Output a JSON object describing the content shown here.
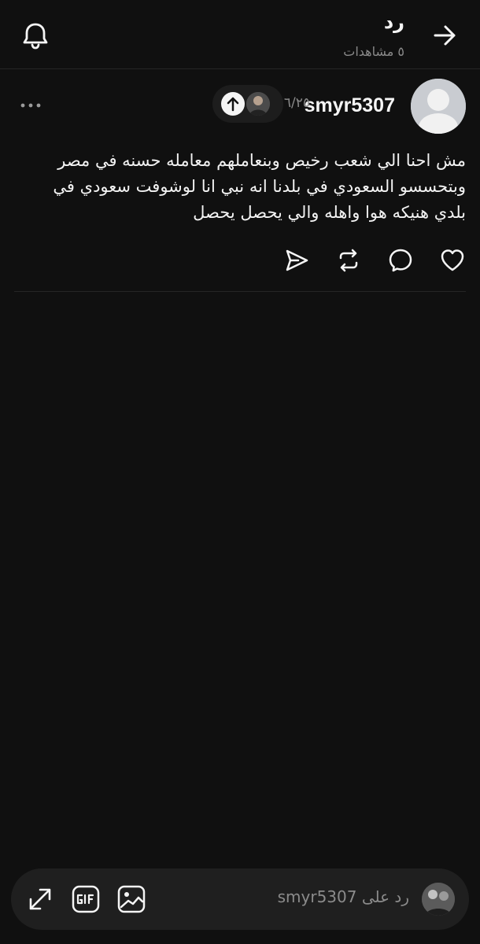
{
  "header": {
    "title": "رد",
    "views": "٥ مشاهدات",
    "back_icon": "arrow-right-icon",
    "notifications_icon": "bell-icon"
  },
  "post": {
    "username": "smyr5307",
    "thread_position": "٦/٢٥",
    "text": "مش احنا الي شعب رخيص وبنعاملهم معامله حسنه في مصر وبتحسسو السعودي في بلدنا انه نبي انا لوشوفت سعودي في بلدي هنيكه هوا واهله والي يحصل يحصل",
    "actions": [
      "like-icon",
      "comment-icon",
      "repost-icon",
      "share-icon"
    ]
  },
  "composer": {
    "placeholder": "رد على smyr5307",
    "tools": [
      "image-icon",
      "gif-icon",
      "expand-icon"
    ]
  },
  "colors": {
    "background": "#101010",
    "text": "#f3f3f3",
    "muted": "#8a8a8a",
    "divider": "#262626",
    "composer_bg": "#1f1f1f"
  }
}
